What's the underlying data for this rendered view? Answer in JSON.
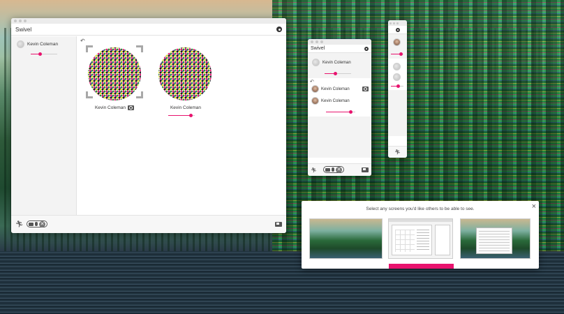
{
  "colors": {
    "accent": "#e8136e"
  },
  "main_window": {
    "title": "Swivel",
    "sidebar": {
      "participant_name": "Kevin Coleman",
      "volume": 0.35
    },
    "tiles": [
      {
        "name": "Kevin Coleman",
        "has_search_badge": true,
        "selected": true
      },
      {
        "name": "Kevin Coleman",
        "volume": 0.85
      }
    ],
    "icons": {
      "settings": "gear-icon",
      "undo": "undo-icon",
      "runner": "runner-icon",
      "screen": "screen-share-icon"
    },
    "toolbar": {
      "close_glyph": "✕"
    }
  },
  "mid_window": {
    "title": "Swivel",
    "self": {
      "name": "Kevin Coleman",
      "volume": 0.42
    },
    "participants": [
      {
        "name": "Kevin Coleman",
        "has_search_badge": true
      },
      {
        "name": "Kevin Coleman",
        "volume": 0.85
      }
    ],
    "toolbar": {
      "close_glyph": "✕"
    }
  },
  "mini_window": {
    "volume_top": 0.8,
    "volume_bottom": 0.6
  },
  "screen_picker": {
    "prompt": "Select any screens you'd like others to be able to see.",
    "close_glyph": "×",
    "screens": [
      "screen-1",
      "screen-2",
      "screen-3"
    ]
  }
}
